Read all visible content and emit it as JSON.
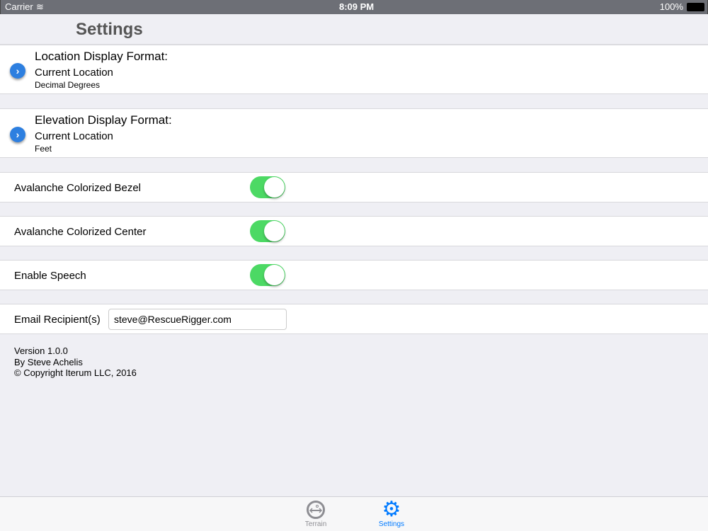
{
  "status": {
    "carrier": "Carrier",
    "time": "8:09 PM",
    "battery": "100%"
  },
  "nav": {
    "title": "Settings"
  },
  "location": {
    "title": "Location Display Format:",
    "subtitle": "Current Location",
    "value": "Decimal Degrees"
  },
  "elevation": {
    "title": "Elevation Display Format:",
    "subtitle": "Current Location",
    "value": "Feet"
  },
  "toggles": [
    {
      "label": "Avalanche Colorized Bezel",
      "on": true
    },
    {
      "label": "Avalanche Colorized Center",
      "on": true
    },
    {
      "label": "Enable Speech",
      "on": true
    }
  ],
  "email": {
    "label": "Email Recipient(s)",
    "value": "steve@RescueRigger.com"
  },
  "info": {
    "version": "Version 1.0.0",
    "author": "By Steve Achelis",
    "copyright": "© Copyright Iterum LLC, 2016"
  },
  "tabs": [
    {
      "label": "Terrain",
      "color": "#8e8e93"
    },
    {
      "label": "Settings",
      "color": "#007aff"
    }
  ]
}
